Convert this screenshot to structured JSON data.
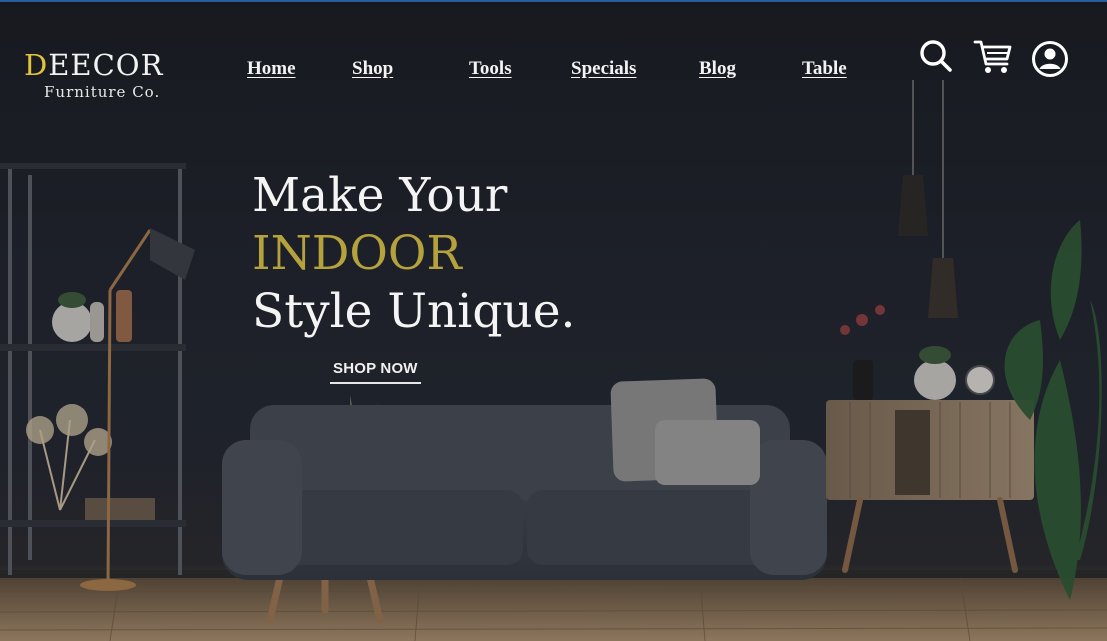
{
  "brand": {
    "initial": "D",
    "name": "EECOR",
    "tagline": "Furniture Co."
  },
  "nav": {
    "home": "Home",
    "shop": "Shop",
    "tools": "Tools",
    "specials": "Specials",
    "blog": "Blog",
    "table": "Table"
  },
  "icons": {
    "search": "search-icon",
    "cart": "cart-icon",
    "account": "user-icon"
  },
  "hero": {
    "line1": "Make Your",
    "line2": "INDOOR",
    "line3": "Style Unique.",
    "cta": "SHOP NOW"
  },
  "colors": {
    "accent": "#b5a23c",
    "logo_accent": "#e0c43c",
    "text": "#f4f4f4"
  }
}
